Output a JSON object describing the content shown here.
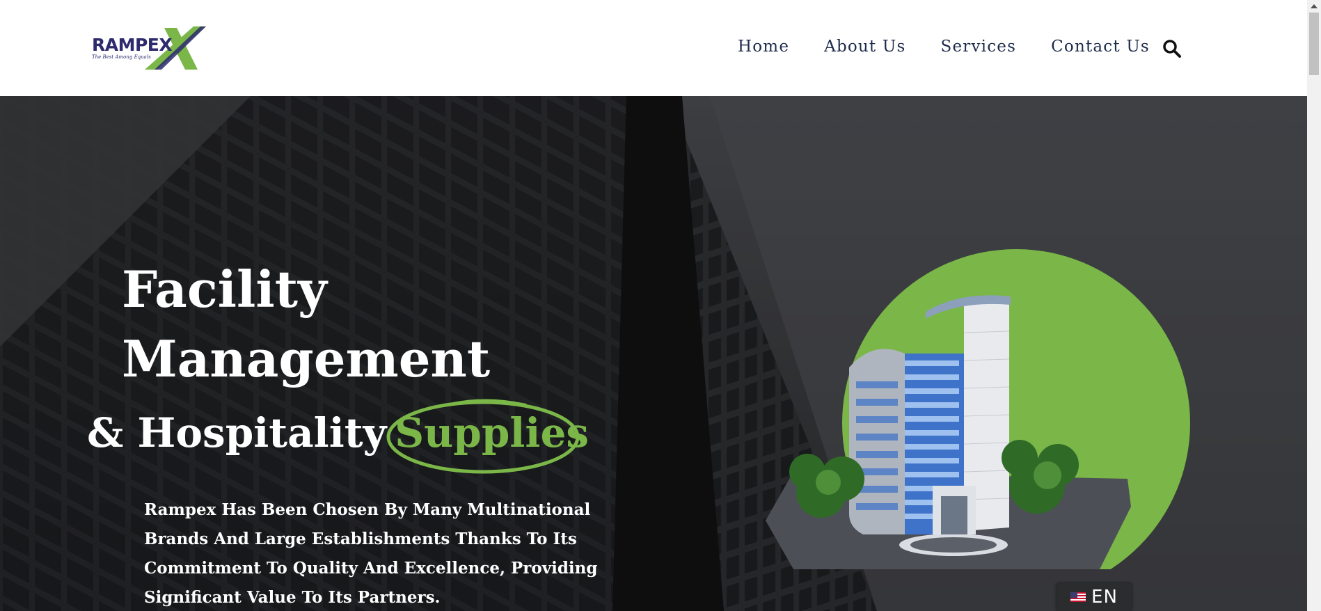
{
  "logo": {
    "name": "RAMPEX",
    "tagline": "The Best Among Equals"
  },
  "nav": {
    "items": [
      {
        "label": "Home"
      },
      {
        "label": "About Us"
      },
      {
        "label": "Services"
      },
      {
        "label": "Contact Us"
      }
    ]
  },
  "hero": {
    "title_line1": "Facility",
    "title_line2": "Management",
    "subtitle_prefix": "& Hospitality",
    "subtitle_highlight": "Supplies",
    "description": "Rampex Has Been Chosen By Many Multinational Brands And Large Establishments Thanks To Its Commitment To Quality And Excellence, Providing Significant Value To Its Partners."
  },
  "language": {
    "code": "EN"
  },
  "icons": {
    "search": "search-icon",
    "flag": "us-flag-icon"
  },
  "colors": {
    "brand_navy": "#2d2a6e",
    "brand_green": "#7ab648",
    "nav_text": "#1d2b4a",
    "hero_text": "#ffffff"
  }
}
